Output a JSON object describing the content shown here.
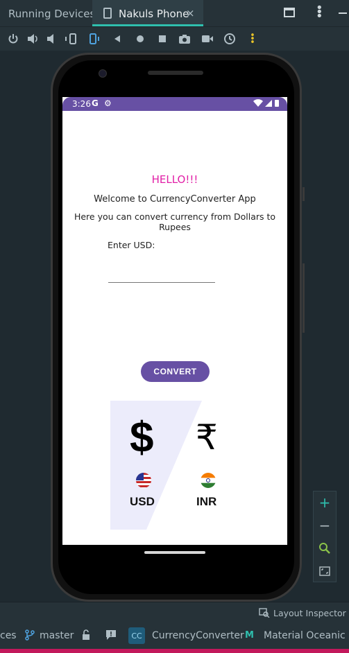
{
  "ide": {
    "running_devices_label": "Running Devices:",
    "active_tab_label": "Nakuls Phone",
    "close_symbol": "×",
    "layout_inspector_label": "Layout Inspector",
    "status": {
      "partial_left": "ces",
      "branch": "master",
      "project_badge": "CC",
      "project_name": "CurrencyConverter",
      "theme_name": "Material Oceanic"
    }
  },
  "toolbar_icons": [
    "power-icon",
    "volume-up-icon",
    "volume-down-icon",
    "rotate-left-icon",
    "rotate-right-icon",
    "back-icon",
    "home-icon",
    "overview-icon",
    "screenshot-icon",
    "screen-record-icon",
    "snapshot-icon",
    "more-icon"
  ],
  "phone": {
    "status_time": "3:26",
    "status_g": "G",
    "status_gear": "⚙",
    "status_right": "▾◢▮"
  },
  "app": {
    "hello": "HELLO!!!",
    "welcome": "Welcome to CurrencyConverter App",
    "description": "Here you can convert currency from Dollars to Rupees",
    "usd_label": "Enter USD:",
    "usd_value": "",
    "convert_label": "CONVERT",
    "dollar_symbol": "$",
    "rupee_symbol": "₹",
    "usd_code": "USD",
    "inr_code": "INR"
  },
  "colors": {
    "app_primary": "#6750a4",
    "hello_color": "#e11fa7",
    "ide_bg": "#263238",
    "active_tab_underline": "#2fbfae"
  }
}
